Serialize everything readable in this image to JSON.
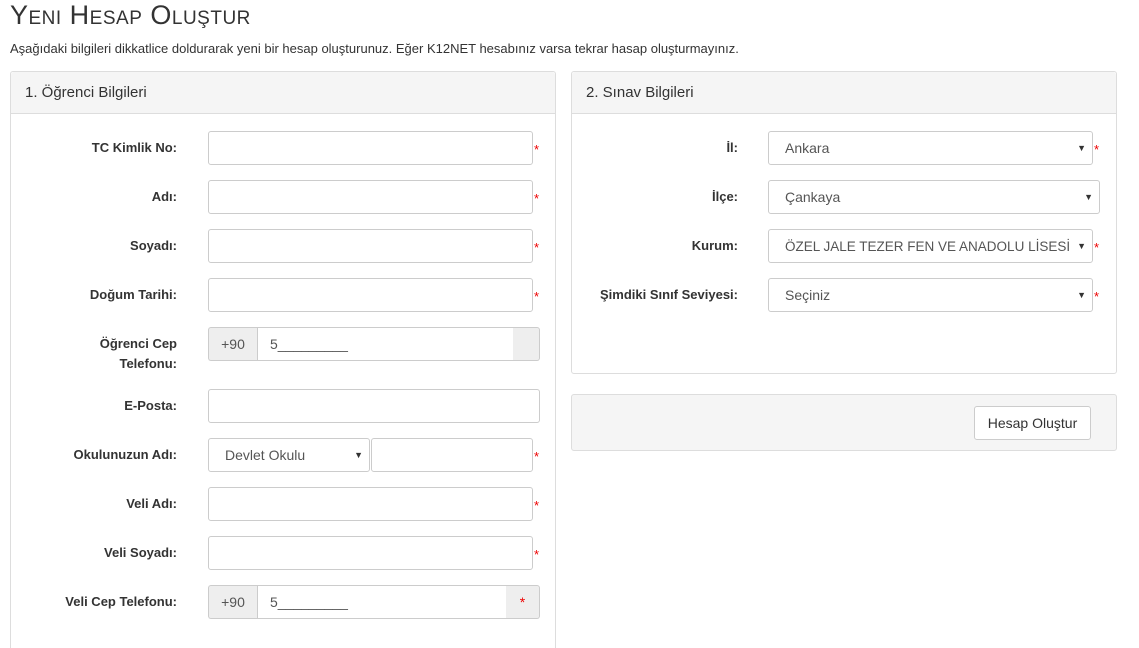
{
  "page": {
    "title": "Yeni Hesap Oluştur",
    "description": "Aşağıdaki bilgileri dikkatlice doldurarak yeni bir hesap oluşturunuz. Eğer K12NET hesabınız varsa tekrar hasap oluşturmayınız."
  },
  "student": {
    "heading": "1. Öğrenci Bilgileri",
    "tc_label": "TC Kimlik No:",
    "name_label": "Adı:",
    "surname_label": "Soyadı:",
    "birth_label": "Doğum Tarihi:",
    "phone_label_1": "Öğrenci Cep",
    "phone_label_2": "Telefonu:",
    "phone_prefix": "+90",
    "phone_value": "5_________",
    "email_label": "E-Posta:",
    "school_label": "Okulunuzun Adı:",
    "school_type": "Devlet Okulu",
    "parent_name_label": "Veli Adı:",
    "parent_surname_label": "Veli Soyadı:",
    "parent_phone_label": "Veli Cep Telefonu:",
    "parent_phone_prefix": "+90",
    "parent_phone_value": "5_________",
    "required_mark": "*"
  },
  "exam": {
    "heading": "2. Sınav Bilgileri",
    "province_label": "İl:",
    "province_value": "Ankara",
    "district_label": "İlçe:",
    "district_value": "Çankaya",
    "institution_label": "Kurum:",
    "institution_value": "ÖZEL JALE TEZER FEN VE ANADOLU LİSESİ",
    "grade_label": "Şimdiki Sınıf Seviyesi:",
    "grade_value": "Seçiniz"
  },
  "submit": {
    "button_label": "Hesap Oluştur"
  },
  "icons": {
    "caret": "▼"
  }
}
